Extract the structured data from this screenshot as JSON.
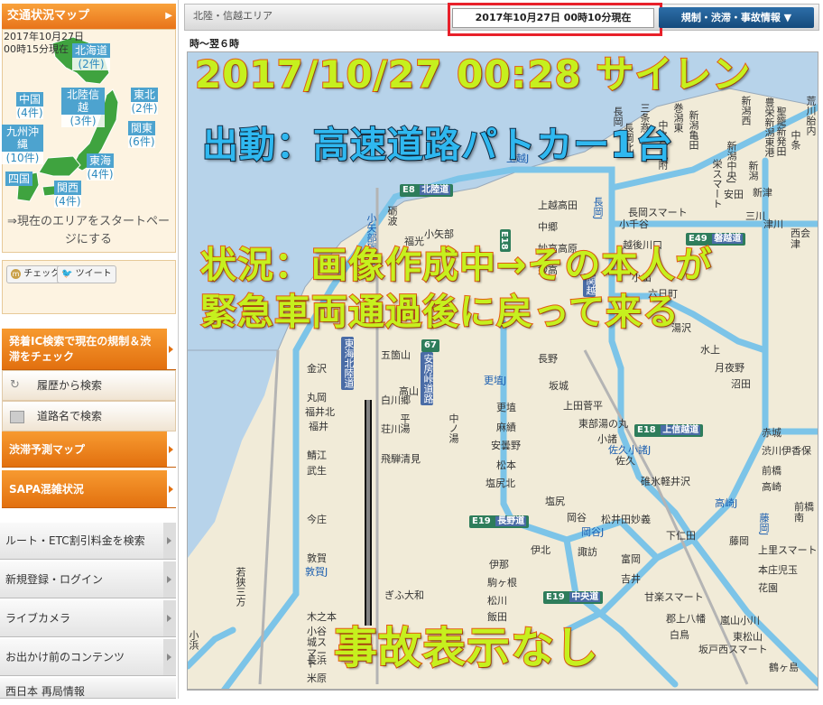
{
  "sidebar": {
    "traffic_map": {
      "title": "交通状況マップ",
      "arrow": "▶",
      "date_line1": "2017年10月27日",
      "date_line2": "00時15分現在",
      "regions": [
        {
          "name": "北海道",
          "count": "(2件)"
        },
        {
          "name": "北陸信越",
          "count": "(3件)"
        },
        {
          "name": "東北",
          "count": "(2件)"
        },
        {
          "name": "中国",
          "count": "(4件)"
        },
        {
          "name": "関東",
          "count": "(6件)"
        },
        {
          "name": "九州沖縄",
          "count": "(10件)"
        },
        {
          "name": "東海",
          "count": "(4件)"
        },
        {
          "name": "四国",
          "count": ""
        },
        {
          "name": "関西",
          "count": "(4件)"
        }
      ],
      "start_link": "⇒現在のエリアをスタートページにする"
    },
    "social": {
      "check": "チェック",
      "tweet": "ツイート"
    },
    "menu": {
      "search_ic": "発着IC検索で現在の規制＆渋滞をチェック",
      "history": "履歴から検索",
      "road_name": "道路名で検索",
      "forecast": "渋滞予測マップ",
      "sapa": "SAPA混雑状況",
      "route": "ルート・ETC割引料金を検索",
      "register": "新規登録・ログイン",
      "live_camera": "ライブカメラ",
      "before_trip": "お出かけ前のコンテンツ",
      "west_japan": "西日本 再局情報"
    }
  },
  "header": {
    "area": "北陸・信越エリア",
    "timestamp": "2017年10月27日 00時10分現在",
    "info_button": "規制・渋滞・事故情報 ▼",
    "range": "時～翌６時"
  },
  "overlay": {
    "headline": "2017/10/27 00:28 サイレン",
    "dispatch": "出動：高速道路パトカー1台",
    "status_line1": "状況：画像作成中→その本人が",
    "status_line2": "緊急車両通過後に戻って来る",
    "no_accident": "事故表示なし"
  },
  "map": {
    "expressways": [
      {
        "code": "E8",
        "name": "北陸道"
      },
      {
        "code": "E49",
        "name": "磐越道"
      },
      {
        "code": "E18",
        "name": "上信越道"
      },
      {
        "code": "E19",
        "name": "長野道"
      },
      {
        "code": "E19",
        "name": "中央道"
      },
      {
        "code": "E18",
        "name": ""
      }
    ],
    "vertical_roads": [
      "東海北陸道",
      "安房峠道路",
      "関越"
    ],
    "vertical_road_codes": [
      "67"
    ],
    "interchanges": [
      "上越J",
      "更埴J",
      "佐久小諸J",
      "高崎J",
      "藤岡J",
      "岡谷J",
      "長岡J",
      "敦賀J",
      "小矢部砺波J"
    ],
    "places_upper": [
      "新潟西",
      "新潟中央J",
      "長岡",
      "三条燕",
      "巻潟東",
      "中之島見附",
      "長岡北",
      "栄スマート",
      "新潟",
      "新津",
      "安田",
      "三川",
      "津川",
      "西会津",
      "荒川胎内",
      "中条",
      "聖籠新発田",
      "豊栄新潟東港",
      "新潟亀田",
      "上越高田",
      "中郷",
      "妙高高原",
      "妙高",
      "長岡スマート",
      "小千谷",
      "越後川口",
      "小出",
      "六日町",
      "湯沢",
      "水上",
      "月夜野",
      "沼田",
      "赤城",
      "渋川伊香保",
      "前橋",
      "高崎",
      "前橋南",
      "藤岡",
      "上里スマート",
      "本庄児玉",
      "花園",
      "嵐山小川",
      "東松山",
      "坂戸西スマート",
      "鶴ヶ島"
    ],
    "places_lower": [
      "小矢部",
      "砺波",
      "福光",
      "五箇山",
      "白川郷",
      "荘川",
      "飛騨清見",
      "高山",
      "平湯",
      "中ノ湯",
      "金沢",
      "丸岡",
      "福井北",
      "福井",
      "鯖江",
      "武生",
      "今庄",
      "敦賀",
      "若狭三方",
      "小浜",
      "木之本",
      "小谷城スマート",
      "長浜",
      "米原",
      "長野",
      "更埴",
      "麻績",
      "安曇野",
      "松本",
      "塩尻北",
      "塩尻",
      "岡谷",
      "諏訪",
      "伊北",
      "伊那",
      "駒ヶ根",
      "松川",
      "飯田",
      "坂城",
      "上田菅平",
      "東部湯の丸",
      "小諸",
      "佐久",
      "碓氷軽井沢",
      "松井田妙義",
      "富岡",
      "吉井",
      "下仁田",
      "甘楽スマート",
      "ぎふ大和",
      "郡上八幡",
      "白鳥",
      "朝日",
      "高岡",
      "富山",
      "立山",
      "滑川",
      "魚津",
      "黒部",
      "入善",
      "朝日",
      "親不知",
      "糸魚川",
      "能生",
      "名立谷浜",
      "上越",
      "柿崎",
      "米山",
      "西山",
      "柏崎",
      "刈羽",
      "西山",
      "長野",
      "須坂長野東",
      "信州中野",
      "豊田飯山",
      "中郷",
      "駒形",
      "太田桐生",
      "鶴ヶ島"
    ]
  }
}
